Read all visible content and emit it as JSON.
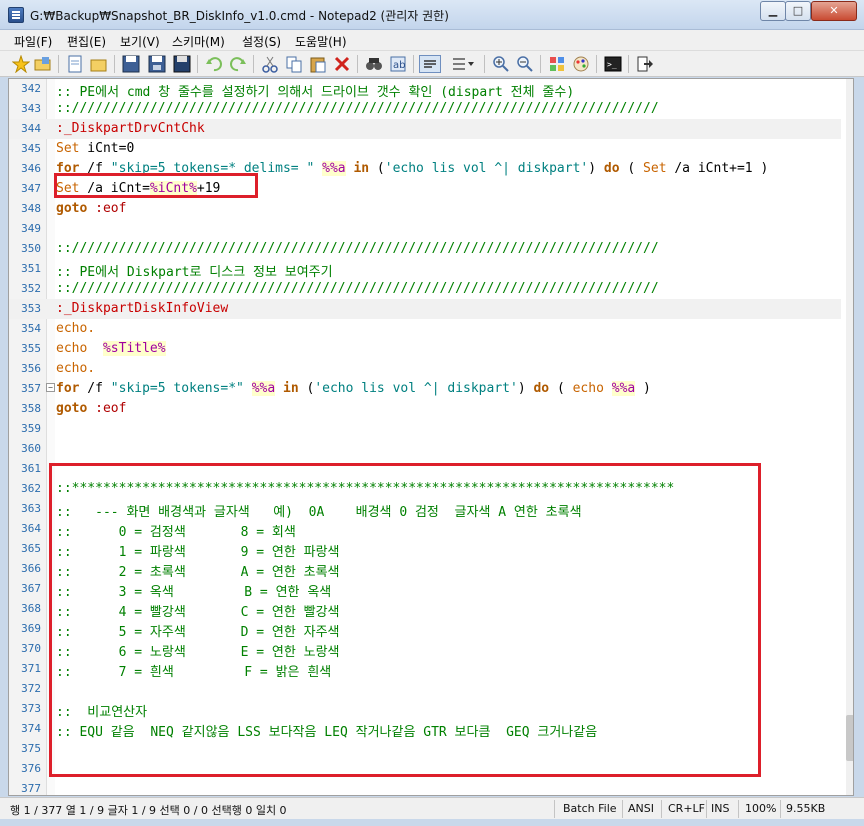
{
  "window": {
    "title": "G:₩Backup₩Snapshot_BR_DiskInfo_v1.0.cmd - Notepad2 (관리자 권한)",
    "min_label": "▁",
    "max_label": "□",
    "close_label": "✕"
  },
  "menu": [
    "파일(F)",
    "편집(E)",
    "보기(V)",
    "스키마(M)",
    "설정(S)",
    "도움말(H)"
  ],
  "toolbar_icons": [
    "new-icon",
    "open-icon",
    "new-file-icon",
    "open-file-icon",
    "save-icon",
    "save-as-icon",
    "undo-icon",
    "redo-icon",
    "cut-icon",
    "copy-icon",
    "paste-icon",
    "delete-icon",
    "find-icon",
    "replace-icon",
    "word-wrap-icon",
    "list-icon",
    "zoom-in-icon",
    "zoom-out-icon",
    "scheme-icon",
    "color-icon",
    "console-icon",
    "exit-icon"
  ],
  "lines": [
    {
      "n": "342",
      "segs": [
        [
          ":: PE에서 cmd 창 줄수를 설정하기 의해서 드라이브 갯수 확인 (dispart 전체 줄수)",
          "cmt"
        ]
      ]
    },
    {
      "n": "343",
      "segs": [
        [
          "::///////////////////////////////////////////////////////////////////////////",
          "cmt"
        ]
      ]
    },
    {
      "n": "344",
      "hl": true,
      "segs": [
        [
          ":_DiskpartDrvCntChk",
          "lbl"
        ]
      ]
    },
    {
      "n": "345",
      "segs": [
        [
          "Set",
          "kw2"
        ],
        [
          " iCnt=0",
          "txt"
        ]
      ]
    },
    {
      "n": "346",
      "segs": [
        [
          "for",
          "kw"
        ],
        [
          " /f ",
          "txt"
        ],
        [
          "\"skip=5 tokens=* delims= \"",
          "str"
        ],
        [
          " ",
          "txt"
        ],
        [
          "%%a",
          "var"
        ],
        [
          " ",
          "txt"
        ],
        [
          "in",
          "kw"
        ],
        [
          " (",
          "txt"
        ],
        [
          "'echo lis vol ^| diskpart'",
          "str"
        ],
        [
          ") ",
          "txt"
        ],
        [
          "do",
          "kw"
        ],
        [
          " ( ",
          "txt"
        ],
        [
          "Set",
          "kw2"
        ],
        [
          " /a iCnt+=1 )",
          "txt"
        ]
      ]
    },
    {
      "n": "347",
      "segs": [
        [
          "Set",
          "kw2"
        ],
        [
          " /a iCnt=",
          "txt"
        ],
        [
          "%iCnt%",
          "var"
        ],
        [
          "+19",
          "txt"
        ]
      ]
    },
    {
      "n": "348",
      "segs": [
        [
          "goto",
          "kw"
        ],
        [
          " ",
          "txt"
        ],
        [
          ":eof",
          "op"
        ]
      ]
    },
    {
      "n": "349",
      "segs": []
    },
    {
      "n": "350",
      "segs": [
        [
          "::///////////////////////////////////////////////////////////////////////////",
          "cmt"
        ]
      ]
    },
    {
      "n": "351",
      "segs": [
        [
          ":: PE에서 Diskpart로 디스크 정보 보여주기",
          "cmt"
        ]
      ]
    },
    {
      "n": "352",
      "segs": [
        [
          "::///////////////////////////////////////////////////////////////////////////",
          "cmt"
        ]
      ]
    },
    {
      "n": "353",
      "hl": true,
      "segs": [
        [
          ":_DiskpartDiskInfoView",
          "lbl"
        ]
      ]
    },
    {
      "n": "354",
      "segs": [
        [
          "echo.",
          "kw2"
        ]
      ]
    },
    {
      "n": "355",
      "segs": [
        [
          "echo",
          "kw2"
        ],
        [
          "  ",
          "txt"
        ],
        [
          "%sTitle%",
          "var"
        ]
      ]
    },
    {
      "n": "356",
      "segs": [
        [
          "echo.",
          "kw2"
        ]
      ]
    },
    {
      "n": "357",
      "fold": true,
      "segs": [
        [
          "for",
          "kw"
        ],
        [
          " /f ",
          "txt"
        ],
        [
          "\"skip=5 tokens=*\"",
          "str"
        ],
        [
          " ",
          "txt"
        ],
        [
          "%%a",
          "var"
        ],
        [
          " ",
          "txt"
        ],
        [
          "in",
          "kw"
        ],
        [
          " (",
          "txt"
        ],
        [
          "'echo lis vol ^| diskpart'",
          "str"
        ],
        [
          ") ",
          "txt"
        ],
        [
          "do",
          "kw"
        ],
        [
          " ( ",
          "txt"
        ],
        [
          "echo",
          "kw2"
        ],
        [
          " ",
          "txt"
        ],
        [
          "%%a",
          "var"
        ],
        [
          " )",
          "txt"
        ]
      ]
    },
    {
      "n": "358",
      "segs": [
        [
          "goto",
          "kw"
        ],
        [
          " ",
          "txt"
        ],
        [
          ":eof",
          "op"
        ]
      ]
    },
    {
      "n": "359",
      "segs": []
    },
    {
      "n": "360",
      "segs": []
    },
    {
      "n": "361",
      "segs": []
    },
    {
      "n": "362",
      "segs": [
        [
          "::*****************************************************************************",
          "cmt"
        ]
      ]
    },
    {
      "n": "363",
      "segs": [
        [
          "::   --- 화면 배경색과 글자색   예)  0A    배경색 0 검정  글자색 A 연한 초록색",
          "cmt"
        ]
      ]
    },
    {
      "n": "364",
      "segs": [
        [
          "::      0 = 검정색       8 = 회색",
          "cmt"
        ]
      ]
    },
    {
      "n": "365",
      "segs": [
        [
          "::      1 = 파랑색       9 = 연한 파랑색",
          "cmt"
        ]
      ]
    },
    {
      "n": "366",
      "segs": [
        [
          "::      2 = 초록색       A = 연한 초록색",
          "cmt"
        ]
      ]
    },
    {
      "n": "367",
      "segs": [
        [
          "::      3 = 옥색         B = 연한 옥색",
          "cmt"
        ]
      ]
    },
    {
      "n": "368",
      "segs": [
        [
          "::      4 = 빨강색       C = 연한 빨강색",
          "cmt"
        ]
      ]
    },
    {
      "n": "369",
      "segs": [
        [
          "::      5 = 자주색       D = 연한 자주색",
          "cmt"
        ]
      ]
    },
    {
      "n": "370",
      "segs": [
        [
          "::      6 = 노랑색       E = 연한 노랑색",
          "cmt"
        ]
      ]
    },
    {
      "n": "371",
      "segs": [
        [
          "::      7 = 흰색         F = 밝은 흰색",
          "cmt"
        ]
      ]
    },
    {
      "n": "372",
      "segs": []
    },
    {
      "n": "373",
      "segs": [
        [
          "::  비교연산자",
          "cmt"
        ]
      ]
    },
    {
      "n": "374",
      "segs": [
        [
          ":: EQU 같음  NEQ 같지않음 LSS 보다작음 LEQ 작거나같음 GTR 보다큼  GEQ 크거나같음",
          "cmt"
        ]
      ]
    },
    {
      "n": "375",
      "segs": []
    },
    {
      "n": "376",
      "segs": []
    },
    {
      "n": "377",
      "segs": []
    }
  ],
  "status": {
    "position": "행 1 / 377  열 1 / 9  글자 1 / 9  선택 0 / 0  선택행 0  일치 0",
    "scheme": "Batch File",
    "encoding": "ANSI",
    "eol": "CR+LF",
    "ins": "INS",
    "zoom": "100%",
    "size": "9.55KB"
  }
}
